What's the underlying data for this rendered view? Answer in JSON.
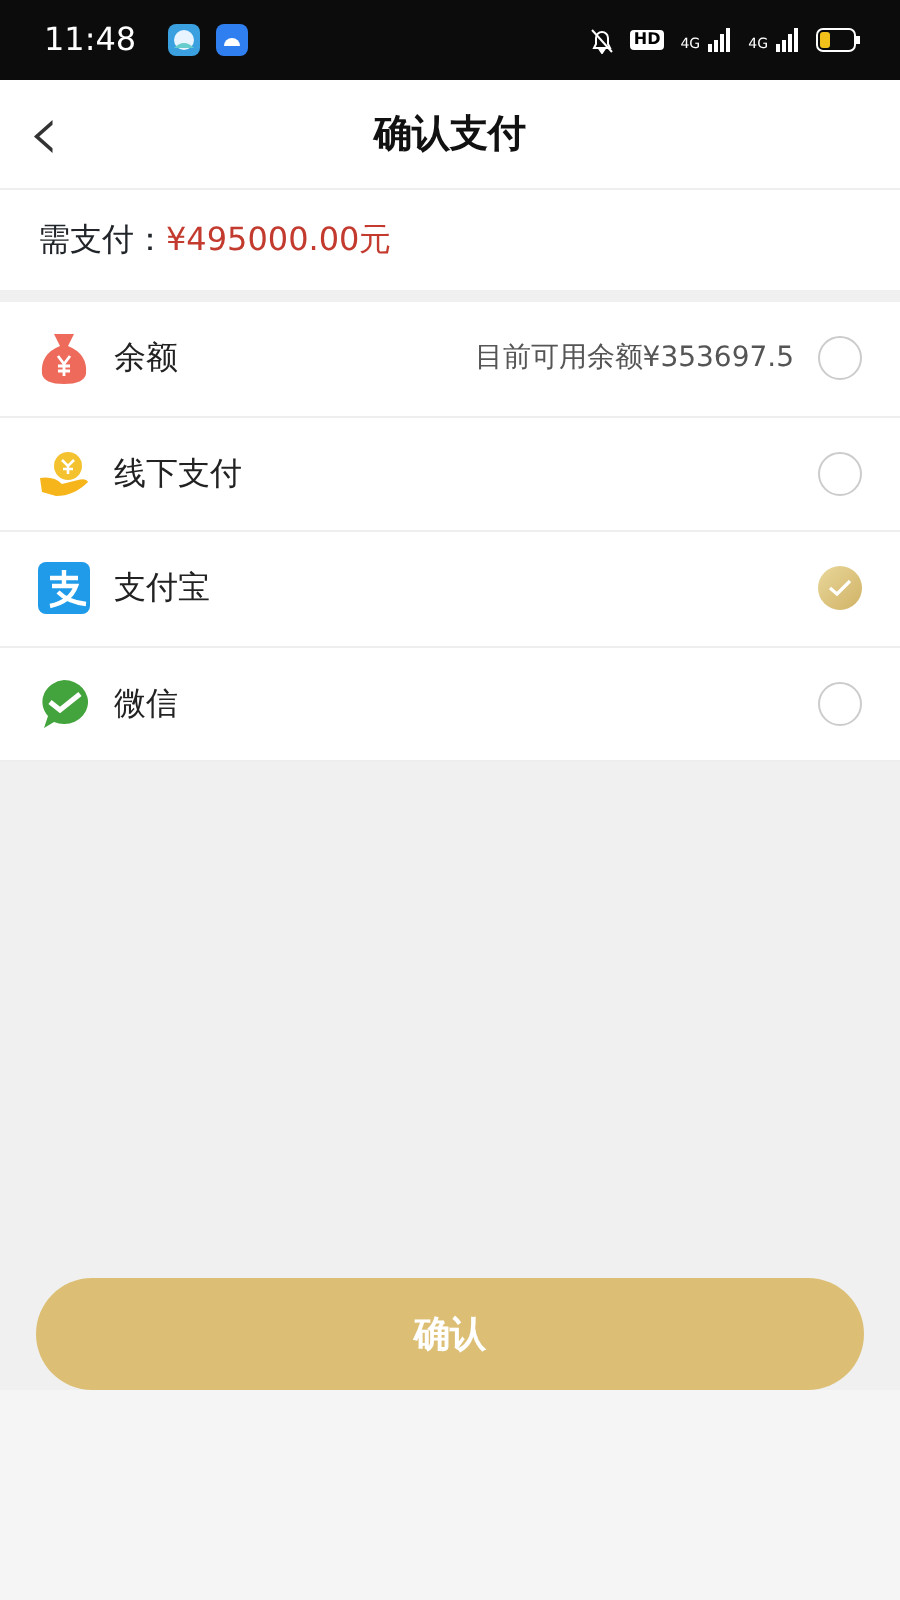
{
  "status_bar": {
    "time": "11:48",
    "hd": "HD",
    "signals": [
      "4G",
      "4G"
    ]
  },
  "header": {
    "back": "‹",
    "title": "确认支付"
  },
  "amount": {
    "label": "需支付：",
    "value": "¥495000.00元"
  },
  "methods": [
    {
      "kind": "balance",
      "name": "余额",
      "note": "目前可用余额¥353697.5",
      "selected": false
    },
    {
      "kind": "offline",
      "name": "线下支付",
      "selected": false
    },
    {
      "kind": "alipay",
      "name": "支付宝",
      "selected": true
    },
    {
      "kind": "wechat",
      "name": "微信",
      "selected": false
    }
  ],
  "confirm_button": "确认"
}
